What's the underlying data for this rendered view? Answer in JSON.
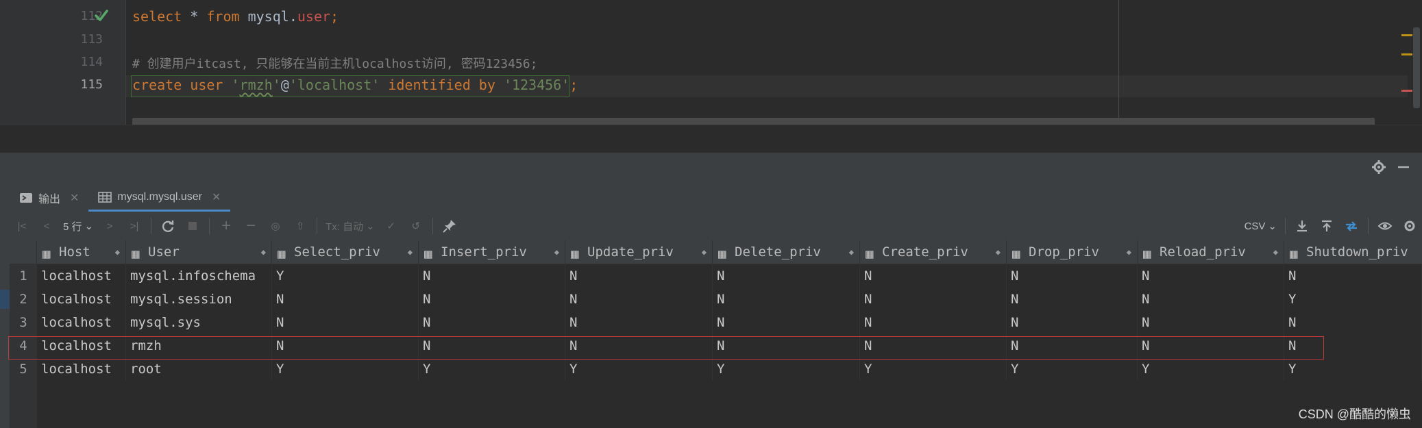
{
  "editor": {
    "lines": [
      {
        "num": "112",
        "status": "check-icon"
      },
      {
        "num": "113"
      },
      {
        "num": "114"
      },
      {
        "num": "115"
      }
    ],
    "code_112": {
      "kw1": "select",
      "star": " * ",
      "kw2": "from",
      "sp": " ",
      "schema": "mysql",
      "dot": ".",
      "table": "user",
      "semi": ";"
    },
    "comment_114": "# 创建用户itcast, 只能够在当前主机localhost访问, 密码123456;",
    "code_115": {
      "kw1": "create",
      "kw2": "user",
      "q1": "'",
      "user": "rmzh",
      "q2": "'",
      "at": "@",
      "host": "'localhost'",
      "kw3": "identified",
      "kw4": "by",
      "pwd": "'123456'",
      "semi": ";"
    }
  },
  "panel": {
    "tabs": [
      {
        "label": "输出",
        "icon": "console-icon"
      },
      {
        "label": "mysql.mysql.user",
        "icon": "table-icon",
        "active": true
      }
    ],
    "toolbar": {
      "rows_label": "5 行",
      "tx_label": "Tx: 自动",
      "format_label": "CSV"
    },
    "grid": {
      "columns": [
        "Host",
        "User",
        "Select_priv",
        "Insert_priv",
        "Update_priv",
        "Delete_priv",
        "Create_priv",
        "Drop_priv",
        "Reload_priv",
        "Shutdown_priv"
      ],
      "rows": [
        {
          "n": "1",
          "cells": [
            "localhost",
            "mysql.infoschema",
            "Y",
            "N",
            "N",
            "N",
            "N",
            "N",
            "N",
            "N"
          ]
        },
        {
          "n": "2",
          "cells": [
            "localhost",
            "mysql.session",
            "N",
            "N",
            "N",
            "N",
            "N",
            "N",
            "N",
            "Y"
          ]
        },
        {
          "n": "3",
          "cells": [
            "localhost",
            "mysql.sys",
            "N",
            "N",
            "N",
            "N",
            "N",
            "N",
            "N",
            "N"
          ]
        },
        {
          "n": "4",
          "cells": [
            "localhost",
            "rmzh",
            "N",
            "N",
            "N",
            "N",
            "N",
            "N",
            "N",
            "N"
          ]
        },
        {
          "n": "5",
          "cells": [
            "localhost",
            "root",
            "Y",
            "Y",
            "Y",
            "Y",
            "Y",
            "Y",
            "Y",
            "Y"
          ]
        }
      ]
    }
  },
  "watermark": "CSDN @酷酷的懒虫",
  "colors": {
    "keyword": "#cc7832",
    "string": "#6a8759",
    "table": "#c75450",
    "comment": "#808080",
    "highlight_border": "#c0393b",
    "accent": "#4a88c7"
  }
}
